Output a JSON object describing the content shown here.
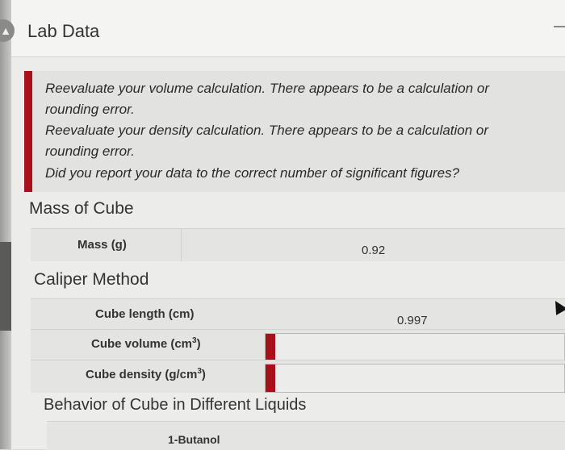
{
  "header": {
    "title": "Lab Data"
  },
  "feedback": {
    "lines": [
      "Reevaluate your volume calculation. There appears to be a calculation or",
      "rounding error.",
      "Reevaluate your density calculation. There appears to be a calculation or",
      "rounding error.",
      "Did you report your data to the correct number of significant figures?"
    ],
    "accent": "#a8111b"
  },
  "mass_section": {
    "title": "Mass of Cube",
    "mass_label": "Mass (g)",
    "mass_value": "0.92"
  },
  "caliper_section": {
    "title": "Caliper Method",
    "length_label": "Cube length (cm)",
    "length_value": "0.997",
    "volume_label_prefix": "Cube volume (cm",
    "volume_label_sup": "3",
    "volume_label_suffix": ")",
    "density_label_prefix": "Cube density (g/cm",
    "density_label_sup": "3",
    "density_label_suffix": ")",
    "volume_value": "",
    "density_value": ""
  },
  "liquids_section": {
    "title": "Behavior of Cube in Different Liquids",
    "first_liquid": "1-Butanol"
  }
}
